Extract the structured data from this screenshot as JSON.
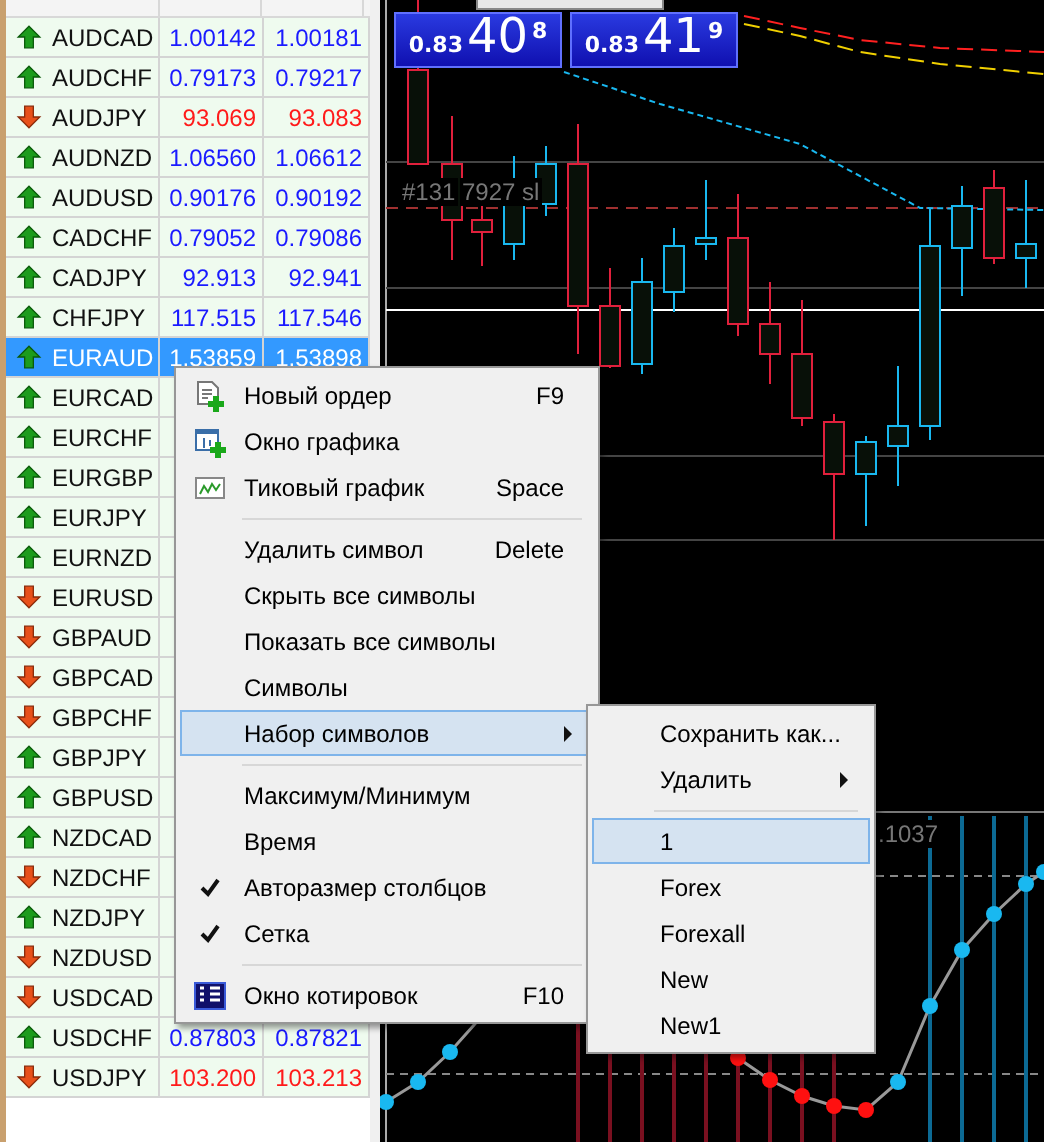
{
  "market_watch": {
    "rows": [
      {
        "symbol": "AUDCAD",
        "bid": "1.00142",
        "ask": "1.00181",
        "up": true,
        "selected": false
      },
      {
        "symbol": "AUDCHF",
        "bid": "0.79173",
        "ask": "0.79217",
        "up": true,
        "selected": false
      },
      {
        "symbol": "AUDJPY",
        "bid": "93.069",
        "ask": "93.083",
        "up": false,
        "selected": false
      },
      {
        "symbol": "AUDNZD",
        "bid": "1.06560",
        "ask": "1.06612",
        "up": true,
        "selected": false
      },
      {
        "symbol": "AUDUSD",
        "bid": "0.90176",
        "ask": "0.90192",
        "up": true,
        "selected": false
      },
      {
        "symbol": "CADCHF",
        "bid": "0.79052",
        "ask": "0.79086",
        "up": true,
        "selected": false
      },
      {
        "symbol": "CADJPY",
        "bid": "92.913",
        "ask": "92.941",
        "up": true,
        "selected": false
      },
      {
        "symbol": "CHFJPY",
        "bid": "117.515",
        "ask": "117.546",
        "up": true,
        "selected": false
      },
      {
        "symbol": "EURAUD",
        "bid": "1.53859",
        "ask": "1.53898",
        "up": true,
        "selected": true
      },
      {
        "symbol": "EURCAD",
        "up": true,
        "selected": false
      },
      {
        "symbol": "EURCHF",
        "up": true,
        "selected": false
      },
      {
        "symbol": "EURGBP",
        "up": true,
        "selected": false
      },
      {
        "symbol": "EURJPY",
        "up": true,
        "selected": false
      },
      {
        "symbol": "EURNZD",
        "up": true,
        "selected": false
      },
      {
        "symbol": "EURUSD",
        "up": false,
        "selected": false
      },
      {
        "symbol": "GBPAUD",
        "up": false,
        "selected": false
      },
      {
        "symbol": "GBPCAD",
        "up": false,
        "selected": false
      },
      {
        "symbol": "GBPCHF",
        "up": false,
        "selected": false
      },
      {
        "symbol": "GBPJPY",
        "up": true,
        "selected": false
      },
      {
        "symbol": "GBPUSD",
        "up": true,
        "selected": false
      },
      {
        "symbol": "NZDCAD",
        "up": true,
        "selected": false
      },
      {
        "symbol": "NZDCHF",
        "up": false,
        "selected": false
      },
      {
        "symbol": "NZDJPY",
        "up": true,
        "selected": false
      },
      {
        "symbol": "NZDUSD",
        "up": false,
        "selected": false
      },
      {
        "symbol": "USDCAD",
        "up": false,
        "selected": false
      },
      {
        "symbol": "USDCHF",
        "bid": "0.87803",
        "ask": "0.87821",
        "up": true,
        "selected": false
      },
      {
        "symbol": "USDJPY",
        "bid": "103.200",
        "ask": "103.213",
        "up": false,
        "selected": false
      }
    ]
  },
  "trade_buttons": [
    {
      "prefix": "0.83",
      "big": "40",
      "small": "8"
    },
    {
      "prefix": "0.83",
      "big": "41",
      "small": "9"
    }
  ],
  "chart": {
    "labels": [
      "#131",
      "7927 sl",
      ".1037"
    ]
  },
  "context_menu": {
    "items": [
      {
        "kind": "item",
        "label": "Новый ордер",
        "shortcut": "F9",
        "checked": false,
        "selected": false,
        "submenu": false
      },
      {
        "kind": "item",
        "label": "Окно графика",
        "checked": false,
        "selected": false,
        "submenu": false
      },
      {
        "kind": "item",
        "label": "Тиковый график",
        "shortcut": "Space",
        "checked": false,
        "selected": false,
        "submenu": false
      },
      {
        "kind": "separator"
      },
      {
        "kind": "item",
        "label": "Удалить символ",
        "shortcut": "Delete",
        "checked": false,
        "selected": false,
        "submenu": false
      },
      {
        "kind": "item",
        "label": "Скрыть все символы",
        "checked": false,
        "selected": false,
        "submenu": false
      },
      {
        "kind": "item",
        "label": "Показать все символы",
        "checked": false,
        "selected": false,
        "submenu": false
      },
      {
        "kind": "item",
        "label": "Символы",
        "checked": false,
        "selected": false,
        "submenu": false
      },
      {
        "kind": "item",
        "label": "Набор символов",
        "checked": false,
        "selected": true,
        "submenu": true
      },
      {
        "kind": "separator"
      },
      {
        "kind": "item",
        "label": "Максимум/Минимум",
        "checked": false,
        "selected": false,
        "submenu": false
      },
      {
        "kind": "item",
        "label": "Время",
        "checked": false,
        "selected": false,
        "submenu": false
      },
      {
        "kind": "item",
        "label": "Авторазмер столбцов",
        "checked": true,
        "selected": false,
        "submenu": false
      },
      {
        "kind": "item",
        "label": "Сетка",
        "checked": true,
        "selected": false,
        "submenu": false
      },
      {
        "kind": "separator"
      },
      {
        "kind": "item",
        "label": "Окно котировок",
        "shortcut": "F10",
        "checked": false,
        "selected": false,
        "submenu": false
      }
    ]
  },
  "submenu": {
    "items": [
      {
        "kind": "item",
        "label": "Сохранить как...",
        "selected": false,
        "submenu": false
      },
      {
        "kind": "item",
        "label": "Удалить",
        "selected": false,
        "submenu": true
      },
      {
        "kind": "separator"
      },
      {
        "kind": "item",
        "label": "1",
        "selected": true,
        "submenu": false
      },
      {
        "kind": "item",
        "label": "Forex",
        "selected": false,
        "submenu": false
      },
      {
        "kind": "item",
        "label": "Forexall",
        "selected": false,
        "submenu": false
      },
      {
        "kind": "item",
        "label": "New",
        "selected": false,
        "submenu": false
      },
      {
        "kind": "item",
        "label": "New1",
        "selected": false,
        "submenu": false
      }
    ]
  }
}
